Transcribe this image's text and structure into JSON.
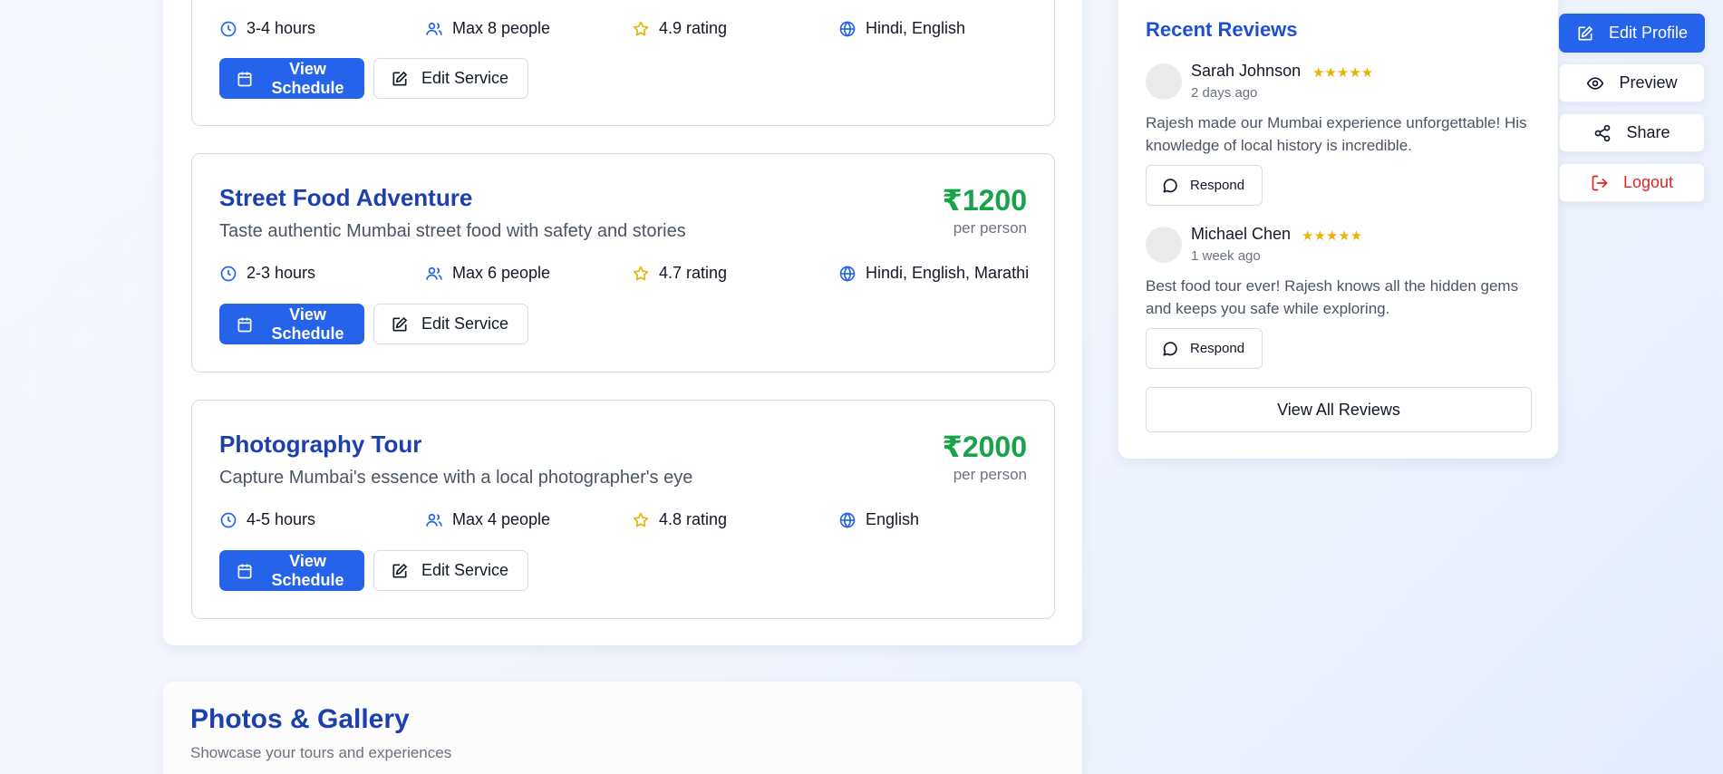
{
  "services": [
    {
      "title": "",
      "description": "",
      "price": "",
      "price_unit": "",
      "duration": "3-4 hours",
      "group": "Max 8 people",
      "rating": "4.9 rating",
      "languages": "Hindi, English",
      "view_label": "View Schedule",
      "edit_label": "Edit Service"
    },
    {
      "title": "Street Food Adventure",
      "description": "Taste authentic Mumbai street food with safety and stories",
      "price": "₹1200",
      "price_unit": "per person",
      "duration": "2-3 hours",
      "group": "Max 6 people",
      "rating": "4.7 rating",
      "languages": "Hindi, English, Marathi",
      "view_label": "View Schedule",
      "edit_label": "Edit Service"
    },
    {
      "title": "Photography Tour",
      "description": "Capture Mumbai's essence with a local photographer's eye",
      "price": "₹2000",
      "price_unit": "per person",
      "duration": "4-5 hours",
      "group": "Max 4 people",
      "rating": "4.8 rating",
      "languages": "English",
      "view_label": "View Schedule",
      "edit_label": "Edit Service"
    }
  ],
  "gallery": {
    "title": "Photos & Gallery",
    "subtitle": "Showcase your tours and experiences"
  },
  "reviews": {
    "title": "Recent Reviews",
    "items": [
      {
        "name": "Sarah Johnson",
        "stars": "★★★★★",
        "date": "2 days ago",
        "text": "Rajesh made our Mumbai experience unforgettable! His knowledge of local history is incredible.",
        "respond_label": "Respond"
      },
      {
        "name": "Michael Chen",
        "stars": "★★★★★",
        "date": "1 week ago",
        "text": "Best food tour ever! Rajesh knows all the hidden gems and keeps you safe while exploring.",
        "respond_label": "Respond"
      }
    ],
    "view_all_label": "View All Reviews"
  },
  "actions": {
    "edit_profile": "Edit Profile",
    "preview": "Preview",
    "share": "Share",
    "logout": "Logout"
  },
  "colors": {
    "primary": "#2563eb",
    "heading": "#1e40af",
    "price": "#16a34a",
    "star": "#eab308",
    "logout": "#dc2626"
  }
}
